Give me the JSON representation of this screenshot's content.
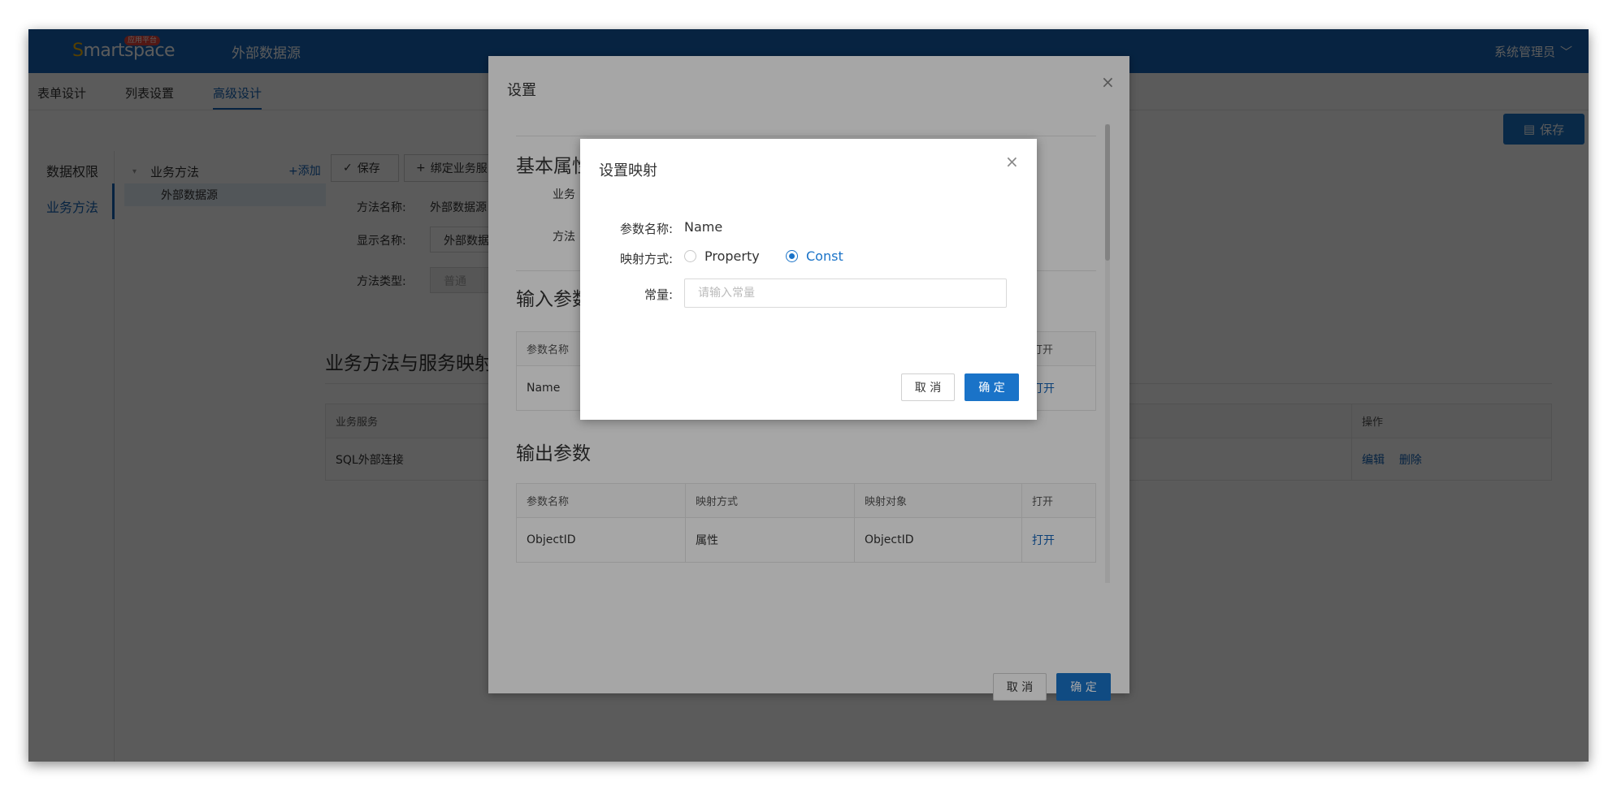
{
  "header": {
    "logo_text_s": "S",
    "logo_text_rest": "martspace",
    "logo_badge": "应用平台",
    "title": "外部数据源",
    "user": "系统管理员",
    "user_caret": "﹀"
  },
  "tabs": [
    "表单设计",
    "列表设置",
    "高级设计"
  ],
  "save_main": {
    "icon": "▤",
    "label": "保存"
  },
  "leftnav": [
    "数据权限",
    "业务方法"
  ],
  "tree": {
    "caret": "▾",
    "root": "业务方法",
    "add": "+添加",
    "child": "外部数据源"
  },
  "toolbar": {
    "save_icon": "✓",
    "save": "保存",
    "bind_icon": "+",
    "bind": "绑定业务服"
  },
  "method_form": {
    "name_label": "方法名称:",
    "name_value": "外部数据源",
    "display_label": "显示名称:",
    "display_value": "外部数据",
    "type_label": "方法类型:",
    "type_value": "普通"
  },
  "mapping_section": {
    "title": "业务方法与服务映射",
    "headers": [
      "业务服务",
      "操作"
    ],
    "rows": [
      {
        "service": "SQL外部连接",
        "edit": "编辑",
        "delete": "删除"
      }
    ]
  },
  "outer_dialog": {
    "title": "设置",
    "basic_title": "基本属性",
    "basic_lbl1": "业务",
    "basic_lbl2": "方法",
    "input_title": "输入参数",
    "input_headers": [
      "参数名称",
      "打开"
    ],
    "input_rows": [
      {
        "name": "Name",
        "open": "打开"
      }
    ],
    "output_title": "输出参数",
    "output_headers": [
      "参数名称",
      "映射方式",
      "映射对象",
      "打开"
    ],
    "output_rows": [
      {
        "name": "ObjectID",
        "mode": "属性",
        "target": "ObjectID",
        "open": "打开"
      }
    ],
    "cancel": "取 消",
    "ok": "确 定"
  },
  "inner_dialog": {
    "title": "设置映射",
    "param_label": "参数名称:",
    "param_value": "Name",
    "mode_label": "映射方式:",
    "mode_options": [
      "Property",
      "Const"
    ],
    "mode_selected": "Const",
    "const_label": "常量:",
    "const_placeholder": "请输入常量",
    "const_value": "",
    "cancel": "取 消",
    "ok": "确 定"
  },
  "icons": {
    "close": "×"
  },
  "colors": {
    "brand_blue": "#1565b8",
    "primary": "#1a73c8"
  }
}
